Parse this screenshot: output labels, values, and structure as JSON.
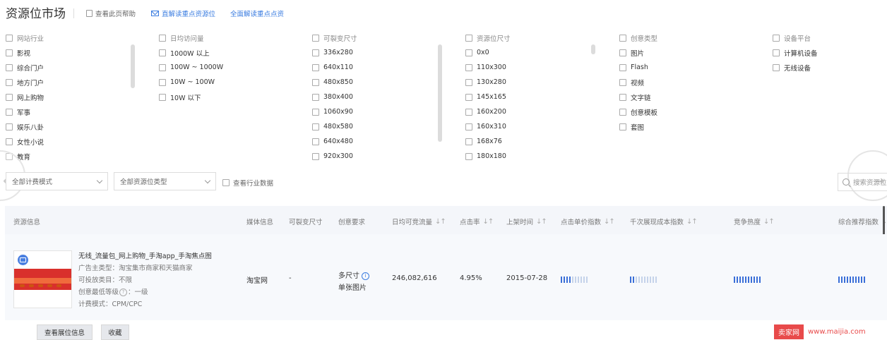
{
  "header": {
    "title": "资源位市场",
    "help_link": "查看此页帮助",
    "link_focus_resources": "直解读重点资源位",
    "link_full_reading": "全面解读重点点资"
  },
  "filters": [
    {
      "header": "网站行业",
      "options": [
        "影视",
        "综合门户",
        "地方门户",
        "网上购物",
        "军事",
        "娱乐八卦",
        "女性小说",
        "教育"
      ]
    },
    {
      "header": "日均访问量",
      "options": [
        "1000W 以上",
        "100W ~ 1000W",
        "10W ~ 100W",
        "10W 以下"
      ]
    },
    {
      "header": "可裂变尺寸",
      "options": [
        "336x280",
        "640x110",
        "480x850",
        "380x400",
        "1060x90",
        "480x580",
        "640x480",
        "920x300"
      ]
    },
    {
      "header": "资源位尺寸",
      "options": [
        "0x0",
        "110x300",
        "130x280",
        "145x165",
        "160x200",
        "160x310",
        "168x76",
        "180x180"
      ]
    },
    {
      "header": "创意类型",
      "options": [
        "图片",
        "Flash",
        "视频",
        "文字链",
        "创意模板",
        "套图"
      ]
    },
    {
      "header": "设备平台",
      "options": [
        "计算机设备",
        "无线设备"
      ]
    }
  ],
  "controls": {
    "billing_mode": "全部计费模式",
    "resource_type": "全部资源位类型",
    "industry_data": "查看行业数据",
    "search_placeholder": "搜索资源位"
  },
  "table": {
    "columns": {
      "resource_info": "资源信息",
      "media_info": "媒体信息",
      "splittable_size": "可裂变尺寸",
      "creative_req": "创意要求",
      "daily_traffic": "日均可竞流量",
      "ctr": "点击率",
      "launch_time": "上架时间",
      "cpc_index": "点击单价指数",
      "cpm_index": "千次展现成本指数",
      "competition": "竞争热度",
      "overall_rec": "综合推荐指数"
    },
    "rows": [
      {
        "name": "无线_流量包_网上购物_手淘app_手淘焦点图",
        "advertiser_type": "广告主类型：淘宝集市商家和天猫商家",
        "category": "可投放类目：不限",
        "creative_level_label": "创意最低等级",
        "creative_level_value": "：一级",
        "billing": "计费模式：CPM/CPC",
        "media": "淘宝网",
        "splittable": "-",
        "creative_line1": "多尺寸",
        "creative_line2": "单张图片",
        "daily_traffic": "246,082,616",
        "ctr": "4.95%",
        "launch_time": "2015-07-28",
        "cpc_index_level": 0.35,
        "cpm_index_level": 0.2,
        "competition_level": 1.0,
        "overall_level": 1.0
      }
    ],
    "actions": {
      "view_info": "查看展位信息",
      "favorite": "收藏"
    }
  },
  "watermark": {
    "brand": "卖家网",
    "url": "www.maijia.com"
  },
  "colors": {
    "accent": "#3a7ce0",
    "heat_high": "#3a6fd8",
    "heat_low": "#c5d3ea",
    "watermark": "#e84a4a"
  }
}
